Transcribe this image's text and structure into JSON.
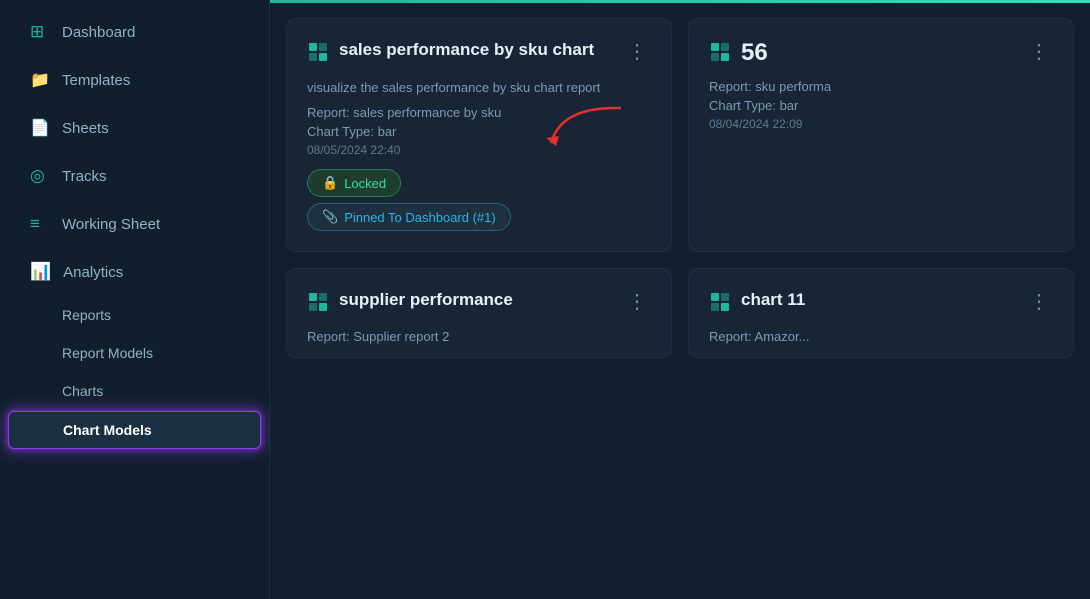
{
  "sidebar": {
    "items": [
      {
        "id": "dashboard",
        "label": "Dashboard",
        "icon": "⊞"
      },
      {
        "id": "templates",
        "label": "Templates",
        "icon": "📁"
      },
      {
        "id": "sheets",
        "label": "Sheets",
        "icon": "📄"
      },
      {
        "id": "tracks",
        "label": "Tracks",
        "icon": "◎"
      },
      {
        "id": "working-sheet",
        "label": "Working Sheet",
        "icon": "≡"
      },
      {
        "id": "analytics",
        "label": "Analytics",
        "icon": "📊"
      }
    ],
    "sub_items": [
      {
        "id": "reports",
        "label": "Reports"
      },
      {
        "id": "report-models",
        "label": "Report Models"
      },
      {
        "id": "charts",
        "label": "Charts"
      },
      {
        "id": "chart-models",
        "label": "Chart Models",
        "active": true
      }
    ]
  },
  "cards": [
    {
      "id": "card1",
      "icon": "✕",
      "title": "sales performance by sku chart",
      "description": "visualize the sales performance by sku chart report",
      "report_label": "Report: sales performance by sku",
      "chart_type_label": "Chart Type: bar",
      "date": "08/05/2024 22:40",
      "badges": [
        {
          "id": "locked",
          "icon": "🔒",
          "label": "Locked",
          "type": "locked"
        },
        {
          "id": "pinned",
          "icon": "📎",
          "label": "Pinned To Dashboard (#1)",
          "type": "pinned"
        }
      ]
    },
    {
      "id": "card2",
      "icon": "✕",
      "title": "56",
      "report_label": "Report: sku performa",
      "chart_type_label": "Chart Type: bar",
      "date": "08/04/2024 22:09"
    }
  ],
  "bottom_cards": [
    {
      "id": "card3",
      "icon": "✕",
      "title": "supplier performance",
      "sub_text": "Report: Supplier report 2"
    },
    {
      "id": "card4",
      "icon": "✕",
      "title": "chart 11",
      "sub_text": "Report: Amazor..."
    }
  ],
  "menu_icon": "⋮",
  "arrow_label": "arrow pointing to locked badge"
}
